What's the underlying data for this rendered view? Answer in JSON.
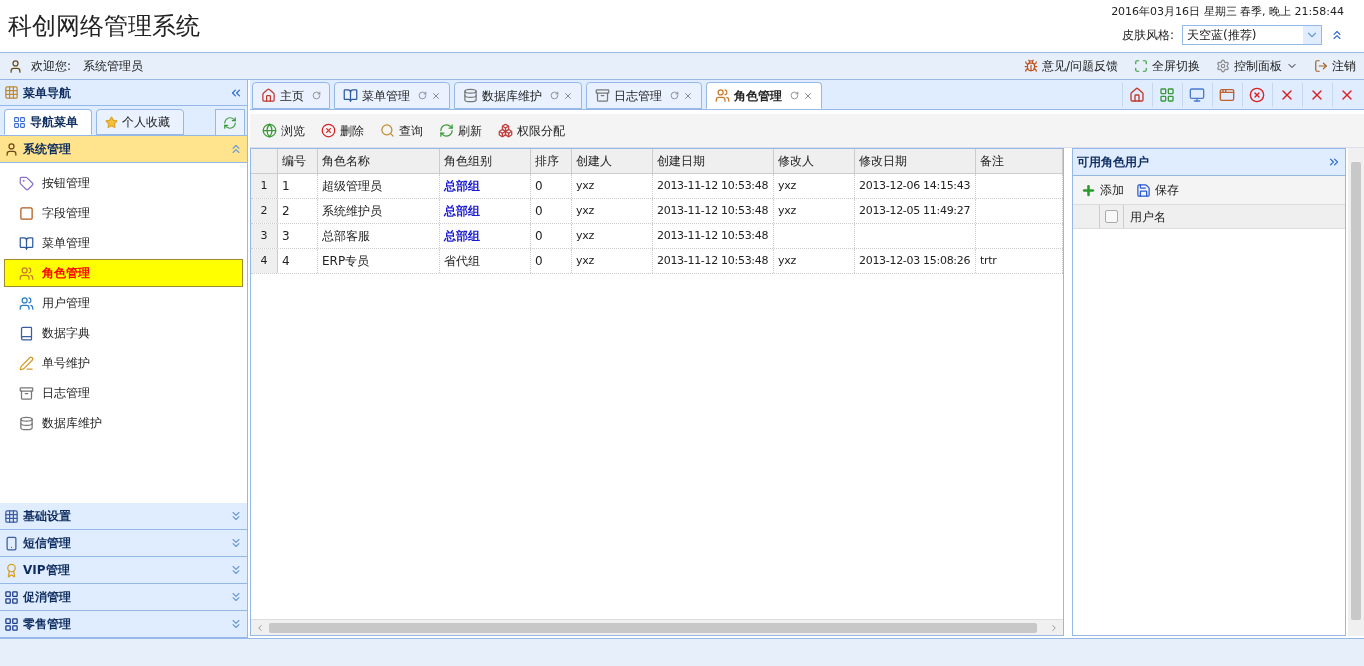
{
  "header": {
    "title": "科创网络管理系统",
    "datetime": "2016年03月16日 星期三 春季, 晚上 21:58:44",
    "skin_label": "皮肤风格:",
    "skin_value": "天空蓝(推荐)"
  },
  "userbar": {
    "welcome": "欢迎您:",
    "user": "系统管理员",
    "actions": [
      "意见/问题反馈",
      "全屏切换",
      "控制面板",
      "注销"
    ]
  },
  "sidebar": {
    "title": "菜单导航",
    "tabs": [
      {
        "label": "导航菜单",
        "selected": true
      },
      {
        "label": "个人收藏",
        "selected": false
      }
    ],
    "groups": [
      {
        "label": "系统管理",
        "expanded": true,
        "items": [
          {
            "label": "按钮管理",
            "selected": false
          },
          {
            "label": "字段管理",
            "selected": false
          },
          {
            "label": "菜单管理",
            "selected": false
          },
          {
            "label": "角色管理",
            "selected": true
          },
          {
            "label": "用户管理",
            "selected": false
          },
          {
            "label": "数据字典",
            "selected": false
          },
          {
            "label": "单号维护",
            "selected": false
          },
          {
            "label": "日志管理",
            "selected": false
          },
          {
            "label": "数据库维护",
            "selected": false
          }
        ]
      },
      {
        "label": "基础设置",
        "expanded": false
      },
      {
        "label": "短信管理",
        "expanded": false
      },
      {
        "label": "VIP管理",
        "expanded": false
      },
      {
        "label": "促消管理",
        "expanded": false
      },
      {
        "label": "零售管理",
        "expanded": false
      }
    ]
  },
  "tabs": [
    {
      "label": "主页",
      "selected": false,
      "closable": false
    },
    {
      "label": "菜单管理",
      "selected": false,
      "closable": true
    },
    {
      "label": "数据库维护",
      "selected": false,
      "closable": true
    },
    {
      "label": "日志管理",
      "selected": false,
      "closable": true
    },
    {
      "label": "角色管理",
      "selected": true,
      "closable": true
    }
  ],
  "toolbar": [
    "浏览",
    "删除",
    "查询",
    "刷新",
    "权限分配"
  ],
  "table": {
    "columns": [
      "编号",
      "角色名称",
      "角色组别",
      "排序",
      "创建人",
      "创建日期",
      "修改人",
      "修改日期",
      "备注"
    ],
    "rows": [
      {
        "number": "1",
        "group_bold": true,
        "cells": [
          "1",
          "超级管理员",
          "总部组",
          "0",
          "yxz",
          "2013-11-12 10:53:48",
          "yxz",
          "2013-12-06 14:15:43",
          ""
        ]
      },
      {
        "number": "2",
        "group_bold": true,
        "cells": [
          "2",
          "系统维护员",
          "总部组",
          "0",
          "yxz",
          "2013-11-12 10:53:48",
          "yxz",
          "2013-12-05 11:49:27",
          ""
        ]
      },
      {
        "number": "3",
        "group_bold": true,
        "cells": [
          "3",
          "总部客服",
          "总部组",
          "0",
          "yxz",
          "2013-11-12 10:53:48",
          "",
          "",
          ""
        ]
      },
      {
        "number": "4",
        "group_bold": false,
        "cells": [
          "4",
          "ERP专员",
          "省代组",
          "0",
          "yxz",
          "2013-11-12 10:53:48",
          "yxz",
          "2013-12-03 15:08:26",
          "trtr"
        ]
      }
    ]
  },
  "side_panel": {
    "title": "可用角色用户",
    "actions": [
      "添加",
      "保存"
    ],
    "columns": [
      "用户名"
    ],
    "select_all_checked": false
  }
}
